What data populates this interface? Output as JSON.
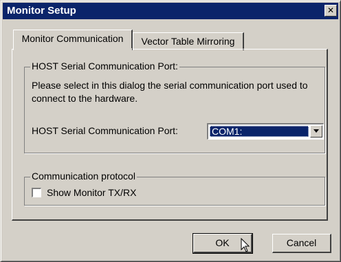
{
  "window": {
    "title": "Monitor Setup",
    "close_glyph": "✕"
  },
  "tabs": [
    {
      "label": "Monitor Communication",
      "active": true
    },
    {
      "label": "Vector Table Mirroring",
      "active": false
    }
  ],
  "host_group": {
    "legend": "HOST Serial Communication Port:",
    "description": "Please select in this dialog the serial communication port used to connect to the hardware.",
    "port_label": "HOST Serial Communication Port:",
    "port_value": "COM1:"
  },
  "protocol_group": {
    "legend": "Communication protocol",
    "checkbox_label": "Show Monitor TX/RX",
    "checked": false
  },
  "buttons": {
    "ok": "OK",
    "cancel": "Cancel"
  },
  "colors": {
    "titlebar": "#0a246a",
    "face": "#d4d0c8",
    "selection": "#0a246a"
  },
  "icons": {
    "combo_arrow": "chevron-down-icon",
    "cursor": "arrow-cursor-icon"
  }
}
